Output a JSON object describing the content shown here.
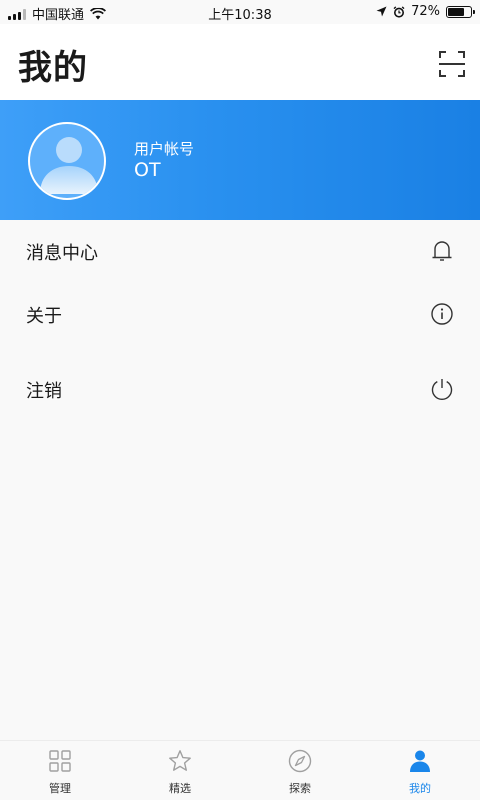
{
  "status_bar": {
    "carrier": "中国联通",
    "time": "上午10:38",
    "battery_percent": "72%",
    "battery_level": 0.72,
    "icons": [
      "signal-icon",
      "wifi-icon",
      "location-icon",
      "alarm-icon",
      "battery-icon"
    ]
  },
  "header": {
    "title": "我的",
    "scan_icon": "scan-icon"
  },
  "profile": {
    "account_label": "用户帐号",
    "account_value": "OT",
    "avatar_icon": "user-avatar-icon",
    "banner_color_start": "#3e9ff8",
    "banner_color_end": "#1a80e4"
  },
  "menu": {
    "items": [
      {
        "label": "消息中心",
        "icon": "bell-icon"
      },
      {
        "label": "关于",
        "icon": "info-icon"
      },
      {
        "label": "注销",
        "icon": "power-icon"
      }
    ]
  },
  "tabbar": {
    "active_color": "#1a86ea",
    "inactive_color": "#a0a0a0",
    "tabs": [
      {
        "label": "管理",
        "icon": "grid-icon"
      },
      {
        "label": "精选",
        "icon": "star-icon"
      },
      {
        "label": "探索",
        "icon": "compass-icon"
      },
      {
        "label": "我的",
        "icon": "person-icon",
        "active": true
      }
    ]
  }
}
